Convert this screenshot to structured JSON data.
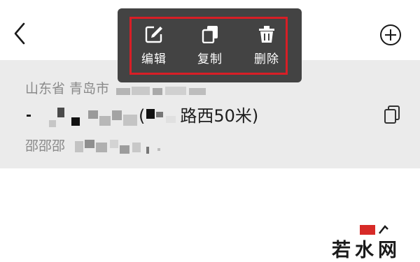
{
  "popup_menu": {
    "items": [
      {
        "label": "编辑",
        "icon": "edit-icon"
      },
      {
        "label": "复制",
        "icon": "copy-icon"
      },
      {
        "label": "删除",
        "icon": "trash-icon"
      }
    ]
  },
  "address": {
    "line1_visible": "山东省 青岛市",
    "line2_paren_open": "(",
    "line2_visible": "路西50米)",
    "contact_name": "邵邵邵"
  },
  "icons": {
    "back": "chevron-left-icon",
    "add": "plus-circle-icon",
    "copy_address": "copy-icon"
  },
  "watermark": {
    "text": "若水网"
  },
  "colors": {
    "popup_bg": "#434343",
    "highlight_border": "#d81e26",
    "card_bg": "#ebebeb"
  }
}
